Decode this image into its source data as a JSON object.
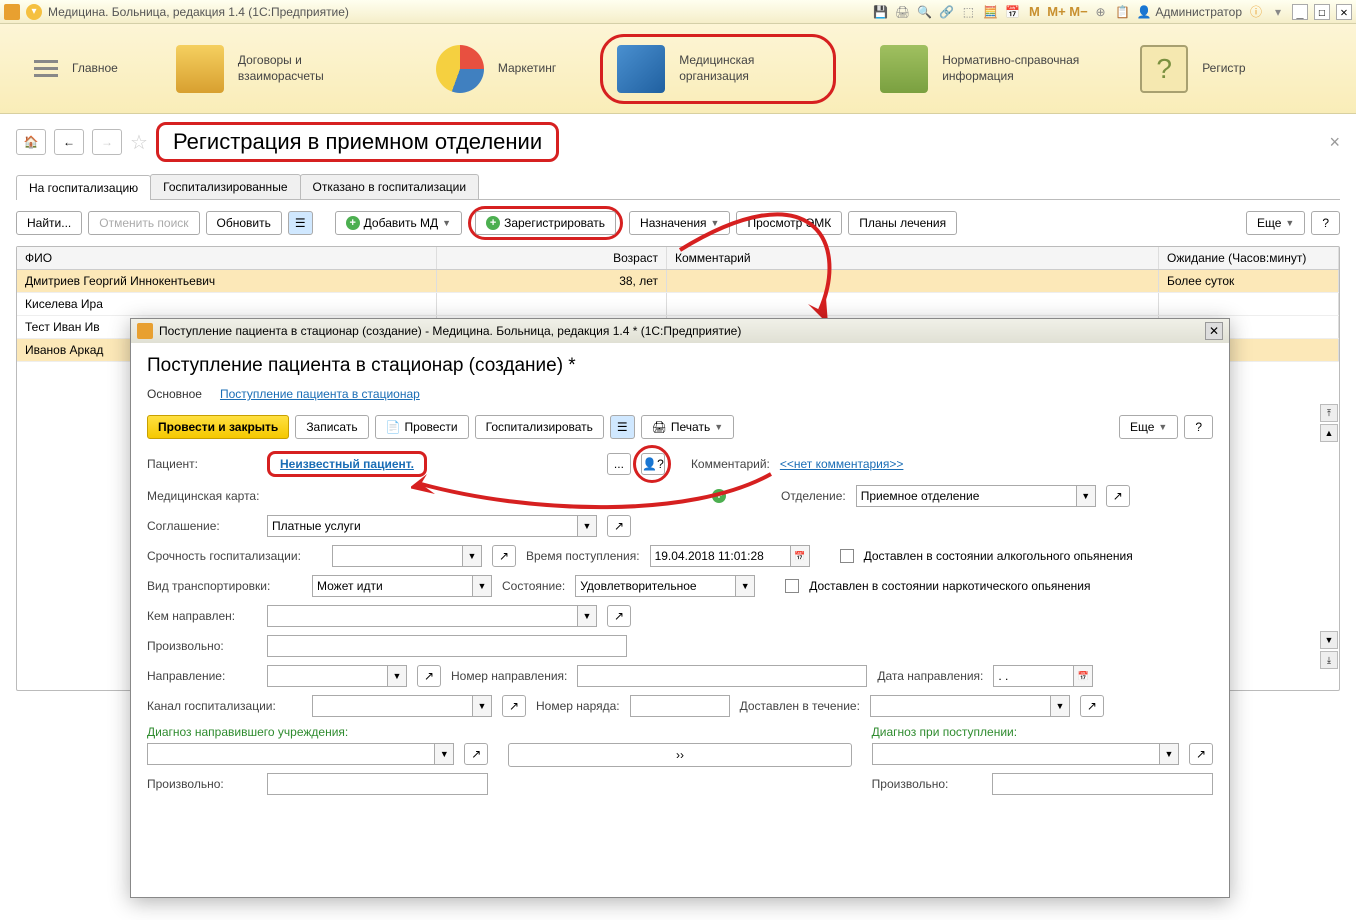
{
  "titlebar": {
    "app": "Медицина. Больница, редакция 1.4  (1С:Предприятие)",
    "user": "Администратор",
    "minimize": "_",
    "maximize": "☐",
    "close": "✕"
  },
  "nav": {
    "main": "Главное",
    "contracts": "Договоры и взаиморасчеты",
    "marketing": "Маркетинг",
    "med_org": "Медицинская организация",
    "reference": "Нормативно-справочная информация",
    "registry": "Регистр"
  },
  "page": {
    "title": "Регистрация в приемном отделении",
    "tabs": [
      "На госпитализацию",
      "Госпитализированные",
      "Отказано в госпитализации"
    ],
    "toolbar": {
      "find": "Найти...",
      "cancel_search": "Отменить поиск",
      "refresh": "Обновить",
      "add_md": "Добавить МД",
      "register": "Зарегистрировать",
      "assignments": "Назначения",
      "view_emk": "Просмотр ЭМК",
      "plans": "Планы лечения",
      "more": "Еще",
      "help": "?"
    },
    "table": {
      "headers": {
        "fio": "ФИО",
        "age": "Возраст",
        "comment": "Комментарий",
        "wait": "Ожидание (Часов:минут)"
      },
      "rows": [
        {
          "fio": "Дмитриев Георгий Иннокентьевич",
          "age": "38, лет",
          "comment": "",
          "wait": "Более суток"
        },
        {
          "fio": "Киселева Ира",
          "age": "",
          "comment": "",
          "wait": ""
        },
        {
          "fio": "Тест Иван Ив",
          "age": "",
          "comment": "",
          "wait": ""
        },
        {
          "fio": "Иванов Аркад",
          "age": "",
          "comment": "",
          "wait": ""
        }
      ]
    }
  },
  "dialog": {
    "wintitle": "Поступление пациента в стационар (создание) - Медицина. Больница, редакция 1.4 * (1С:Предприятие)",
    "title": "Поступление пациента в стационар (создание) *",
    "nav": {
      "main": "Основное",
      "link": "Поступление пациента в стационар"
    },
    "tb": {
      "post_close": "Провести и закрыть",
      "save": "Записать",
      "post": "Провести",
      "hospitalize": "Госпитализировать",
      "print": "Печать",
      "more": "Еще",
      "help": "?"
    },
    "labels": {
      "patient": "Пациент:",
      "patient_link": "Неизвестный пациент.",
      "card": "Медицинская карта:",
      "agreement": "Соглашение:",
      "agreement_val": "Платные услуги",
      "urgency": "Срочность госпитализации:",
      "arrival_time": "Время поступления:",
      "arrival_time_val": "19.04.2018 11:01:28",
      "alcohol": "Доставлен в состоянии алкогольного опьянения",
      "transport": "Вид транспортировки:",
      "transport_val": "Может идти",
      "state": "Состояние:",
      "state_val": "Удовлетворительное",
      "narcotic": "Доставлен в состоянии наркотического опьянения",
      "referred_by": "Кем направлен:",
      "free1": "Произвольно:",
      "direction": "Направление:",
      "direction_no": "Номер направления:",
      "direction_date": "Дата направления:",
      "direction_date_val": ". .",
      "channel": "Канал госпитализации:",
      "order_no": "Номер наряда:",
      "delivered_in": "Доставлен в течение:",
      "diag_ref": "Диагноз направившего учреждения:",
      "diag_adm": "Диагноз при поступлении:",
      "free2": "Произвольно:",
      "free3": "Произвольно:",
      "comment": "Комментарий:",
      "comment_val": "<<нет комментария>>",
      "department": "Отделение:",
      "department_val": "Приемное отделение"
    }
  }
}
